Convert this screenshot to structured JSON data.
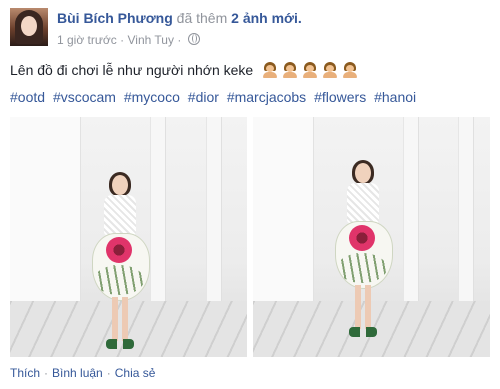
{
  "post": {
    "author": "Bùi Bích Phương",
    "action_text": "đã thêm",
    "photos_link": "2 ảnh mới.",
    "timestamp": "1 giờ trước",
    "location_sep": "·",
    "location": "Vinh Tuy",
    "privacy_icon": "globe-icon",
    "caption": "Lên đồ đi chơi lễ như người nhớn keke",
    "emojis": [
      "woman-emoji",
      "woman-emoji",
      "woman-emoji",
      "woman-emoji",
      "woman-emoji"
    ],
    "hashtags": [
      "#ootd",
      "#vscocam",
      "#mycoco",
      "#dior",
      "#marcjacobs",
      "#flowers",
      "#hanoi"
    ],
    "photos": [
      "photo-1",
      "photo-2"
    ]
  },
  "actions": {
    "like": "Thích",
    "comment": "Bình luận",
    "share": "Chia sẻ",
    "separator": "·"
  },
  "colors": {
    "link": "#365899",
    "muted": "#90949c",
    "text": "#1d2129"
  }
}
